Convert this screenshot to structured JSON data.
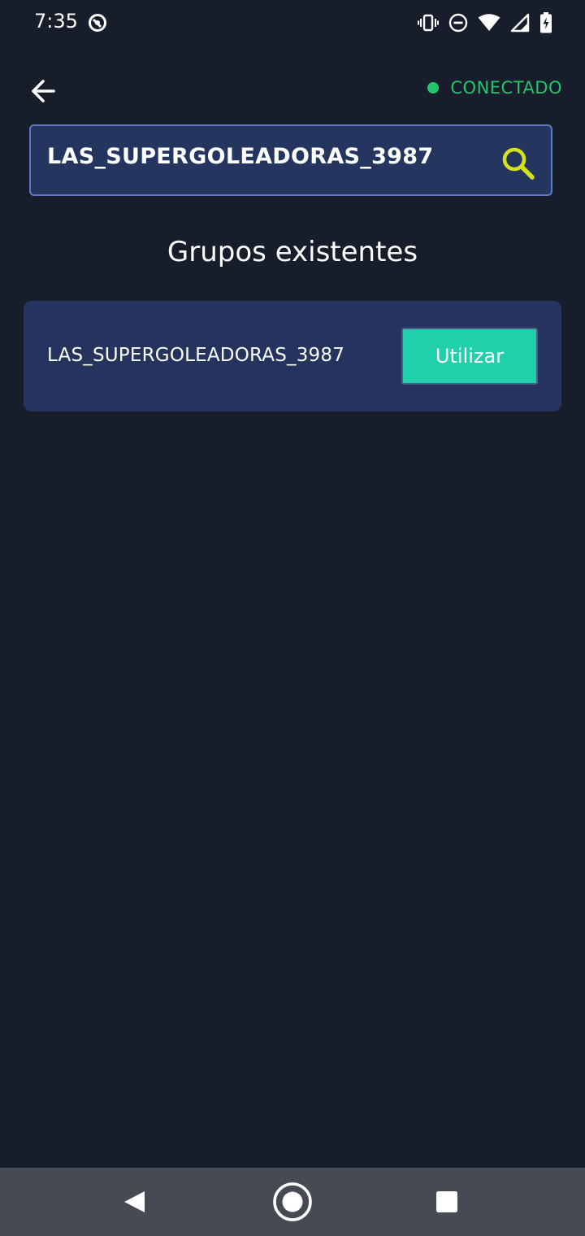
{
  "status_bar": {
    "time": "7:35",
    "icons": [
      "app-notification-icon",
      "vibrate-icon",
      "do-not-disturb-icon",
      "wifi-icon",
      "cell-signal-icon",
      "battery-charging-icon"
    ]
  },
  "header": {
    "back_icon": "arrow-left-icon",
    "connection_label": "CONECTADO",
    "connection_color": "#23c56c"
  },
  "search": {
    "value": "LAS_SUPERGOLEADORAS_3987",
    "icon": "search-icon",
    "icon_color": "#d4e21d"
  },
  "section": {
    "title": "Grupos existentes"
  },
  "groups": [
    {
      "name": "LAS_SUPERGOLEADORAS_3987",
      "button_label": "Utilizar"
    }
  ],
  "colors": {
    "background": "#181d2b",
    "card": "#24345e",
    "button": "#22cfab",
    "nav_bar": "#454a53"
  },
  "nav_bar": {
    "icons": [
      "nav-back-icon",
      "nav-home-icon",
      "nav-recents-icon"
    ]
  }
}
